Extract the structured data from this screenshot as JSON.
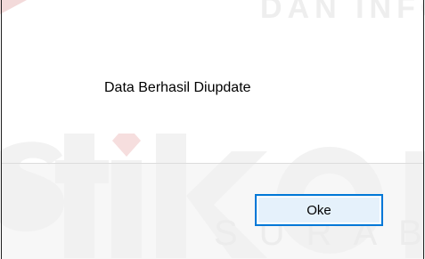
{
  "dialog": {
    "message": "Data Berhasil Diupdate",
    "ok_label": "Oke"
  },
  "watermark": {
    "top_text": "DAN INFO",
    "big_text": "stikom",
    "bottom_text": "SURAB",
    "color": "#ececec",
    "accent": "#f5e1e1"
  },
  "colors": {
    "button_border": "#0078d7",
    "button_bg": "#e5f1fb",
    "footer_bg": "#f0f0f0",
    "frame": "#1f1f1f"
  }
}
